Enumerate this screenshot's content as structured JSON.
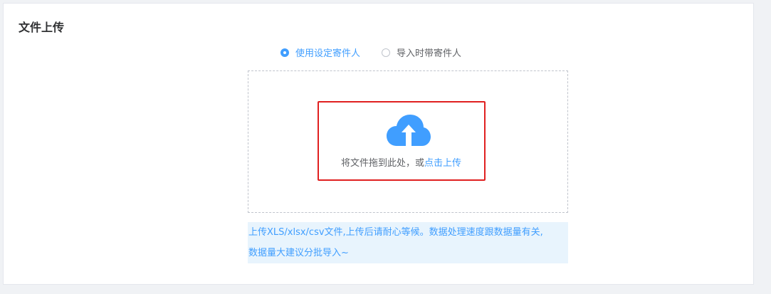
{
  "panel": {
    "title": "文件上传"
  },
  "radio": {
    "option1": "使用设定寄件人",
    "option2": "导入时带寄件人",
    "selected": "option1"
  },
  "upload": {
    "icon": "cloud-upload-icon",
    "drag_text": "将文件拖到此处，或",
    "click_text": "点击上传"
  },
  "tip": {
    "line1": "上传XLS/xlsx/csv文件,上传后请耐心等候。数据处理速度跟数据量有关,",
    "line2": "数据量大建议分批导入~"
  },
  "colors": {
    "accent": "#409eff",
    "highlight": "#e02020",
    "tip_bg": "#e8f4fd"
  }
}
